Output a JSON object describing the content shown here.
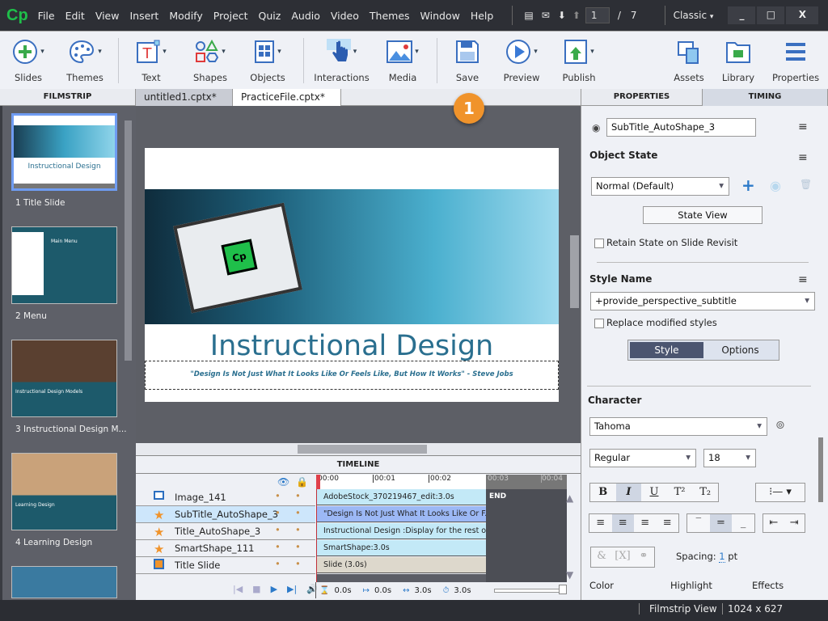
{
  "app": {
    "logo": "Cp",
    "page_current": "1",
    "page_sep": "/",
    "page_total": "7",
    "workspace": "Classic",
    "min": "_",
    "max": "□",
    "close": "X"
  },
  "menu": [
    "File",
    "Edit",
    "View",
    "Insert",
    "Modify",
    "Project",
    "Quiz",
    "Audio",
    "Video",
    "Themes",
    "Window",
    "Help"
  ],
  "toolbar": {
    "slides": "Slides",
    "themes": "Themes",
    "text": "Text",
    "shapes": "Shapes",
    "objects": "Objects",
    "interactions": "Interactions",
    "media": "Media",
    "save": "Save",
    "preview": "Preview",
    "publish": "Publish",
    "assets": "Assets",
    "library": "Library",
    "properties": "Properties"
  },
  "callout": "1",
  "tabs": {
    "filmstrip": "FILMSTRIP",
    "doc1": "untitled1.cptx*",
    "doc2": "PracticeFile.cptx*",
    "close": "×",
    "properties": "PROPERTIES",
    "timing": "TIMING"
  },
  "filmstrip": [
    {
      "label": "1 Title Slide",
      "title": "Instructional Design"
    },
    {
      "label": "2 Menu",
      "title": "Main Menu"
    },
    {
      "label": "3 Instructional Design M...",
      "title": "Instructional Design Models"
    },
    {
      "label": "4 Learning Design",
      "title": "Learning Design"
    }
  ],
  "slide": {
    "title": "Instructional Design",
    "subtitle": "\"Design Is Not Just What It Looks Like Or Feels Like, But How It Works\" - Steve Jobs"
  },
  "timeline": {
    "header": "TIMELINE",
    "ticks": [
      "00:00",
      "00:01",
      "00:02",
      "00:03",
      "00:04"
    ],
    "end": "END",
    "rows": [
      {
        "name": "Image_141",
        "icon": "image-icon",
        "bar": "AdobeStock_370219467_edit:3.0s"
      },
      {
        "name": "SubTitle_AutoShape_3",
        "icon": "star-icon",
        "bar": "\"Design Is Not Just What It Looks Like Or F..."
      },
      {
        "name": "Title_AutoShape_3",
        "icon": "star-icon",
        "bar": "Instructional Design :Display for the rest of ..."
      },
      {
        "name": "SmartShape_111",
        "icon": "star-icon",
        "bar": "SmartShape:3.0s"
      },
      {
        "name": "Title Slide",
        "icon": "slide-icon",
        "bar": "Slide (3.0s)"
      }
    ],
    "start": "0.0s",
    "fade": "0.0s",
    "duration": "3.0s",
    "total": "3.0s"
  },
  "properties": {
    "object_name": "SubTitle_AutoShape_3",
    "object_state": "Object State",
    "state_value": "Normal (Default)",
    "state_view": "State View",
    "retain": "Retain State on Slide Revisit",
    "style_name": "Style Name",
    "style_value": "+provide_perspective_subtitle",
    "replace": "Replace modified styles",
    "tab_style": "Style",
    "tab_options": "Options",
    "character": "Character",
    "font": "Tahoma",
    "font_style": "Regular",
    "font_size": "18",
    "spacing_label": "Spacing:",
    "spacing_value": "1",
    "spacing_unit": "pt",
    "color": "Color",
    "highlight": "Highlight",
    "effects": "Effects"
  },
  "status": {
    "view": "Filmstrip View",
    "size": "1024 x 627"
  },
  "colors": {
    "accent": "#2c7ac9",
    "callout": "#f0932b",
    "title_teal": "#2a6f8f",
    "selected_row": "#cde6fb"
  }
}
